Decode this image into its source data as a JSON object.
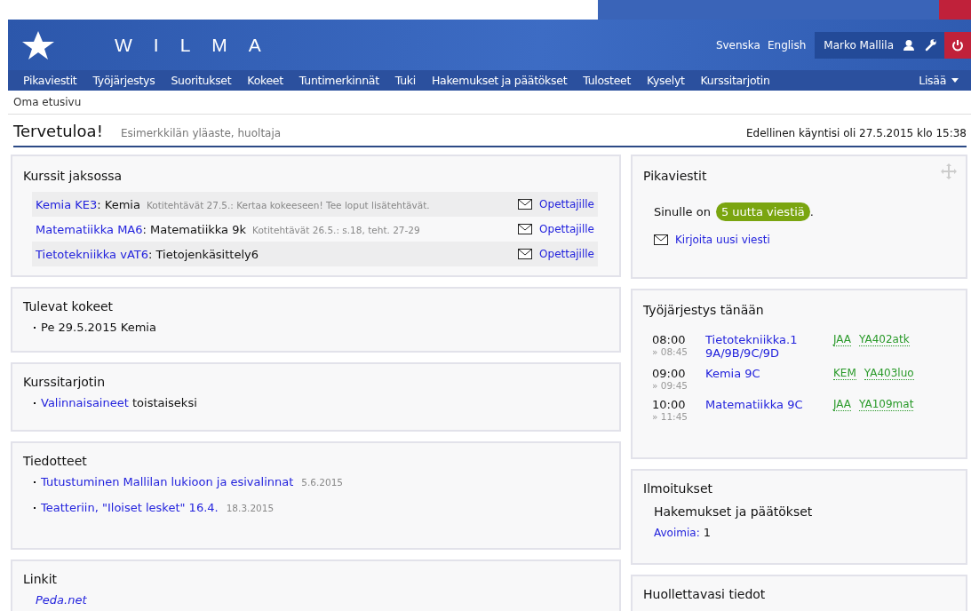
{
  "header": {
    "logo_text": "WILMA",
    "languages": [
      "Svenska",
      "English"
    ],
    "user": "Marko Mallila"
  },
  "nav": {
    "items": [
      "Pikaviestit",
      "Työjärjestys",
      "Suoritukset",
      "Kokeet",
      "Tuntimerkinnät",
      "Tuki",
      "Hakemukset ja päätökset",
      "Tulosteet",
      "Kyselyt",
      "Kurssitarjotin"
    ],
    "more": "Lisää"
  },
  "breadcrumb": "Oma etusivu",
  "title": "Tervetuloa!",
  "subtitle": "Esimerkkilän yläaste, huoltaja",
  "last_visit": "Edellinen käyntisi oli 27.5.2015 klo 15:38",
  "courses": {
    "title": "Kurssit jaksossa",
    "rows": [
      {
        "code": "Kemia KE3",
        "name": ": Kemia",
        "note": "Kotitehtävät 27.5.: Kertaa kokeeseen! Tee loput lisätehtävät.",
        "action": "Opettajille"
      },
      {
        "code": "Matematiikka MA6",
        "name": ": Matematiikka 9k",
        "note": "Kotitehtävät 26.5.: s.18, teht. 27-29",
        "action": "Opettajille"
      },
      {
        "code": "Tietotekniikka vAT6",
        "name": ": Tietojenkäsittely6",
        "note": "",
        "action": "Opettajille"
      }
    ]
  },
  "exams": {
    "title": "Tulevat kokeet",
    "items": [
      "Pe 29.5.2015 Kemia"
    ]
  },
  "offering": {
    "title": "Kurssitarjotin",
    "items": [
      {
        "link": "Valinnaisaineet",
        "text": "toistaiseksi"
      }
    ]
  },
  "announcements": {
    "title": "Tiedotteet",
    "items": [
      {
        "title": "Tutustuminen Mallilan lukioon ja esivalinnat",
        "date": "5.6.2015"
      },
      {
        "title": "Teatteriin, \"Iloiset lesket\" 16.4.",
        "date": "18.3.2015"
      }
    ]
  },
  "links": {
    "title": "Linkit",
    "items": [
      "Peda.net"
    ]
  },
  "messages": {
    "title": "Pikaviestit",
    "text": "Sinulle on",
    "badge": "5 uutta viestiä",
    "after": ".",
    "compose": "Kirjoita uusi viesti"
  },
  "schedule": {
    "title": "Työjärjestys tänään",
    "rows": [
      {
        "start": "08:00",
        "end": "» 08:45",
        "lines": [
          "Tietotekniikka.1",
          "9A/9B/9C/9D"
        ],
        "teacher": "JAA",
        "room": "YA402atk"
      },
      {
        "start": "09:00",
        "end": "» 09:45",
        "lines": [
          "Kemia 9C"
        ],
        "teacher": "KEM",
        "room": "YA403luo"
      },
      {
        "start": "10:00",
        "end": "» 11:45",
        "lines": [
          "Matematiikka 9C"
        ],
        "teacher": "JAA",
        "room": "YA109mat"
      }
    ]
  },
  "notices": {
    "title": "Ilmoitukset",
    "subtitle": "Hakemukset ja päätökset",
    "link": "Avoimia:",
    "value": "1"
  },
  "ward": {
    "title": "Huollettavasi tiedot"
  }
}
